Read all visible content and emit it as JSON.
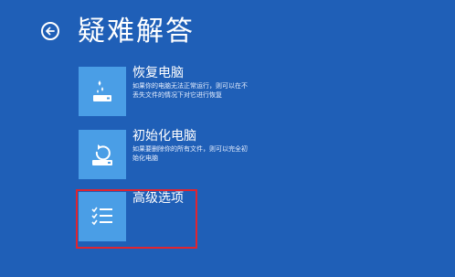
{
  "header": {
    "title": "疑难解答"
  },
  "options": [
    {
      "title": "恢复电脑",
      "description": "如果你的电脑无法正常运行，则可以在不丢失文件的情况下对它进行恢复",
      "icon": "refresh-pc-icon"
    },
    {
      "title": "初始化电脑",
      "description": "如果要删除你的所有文件，则可以完全初始化电脑",
      "icon": "reset-pc-icon"
    },
    {
      "title": "高级选项",
      "description": "",
      "icon": "checklist-icon"
    }
  ],
  "colors": {
    "background": "#1f5fb7",
    "tile": "#4a9ee6",
    "highlight": "#e0242f"
  }
}
